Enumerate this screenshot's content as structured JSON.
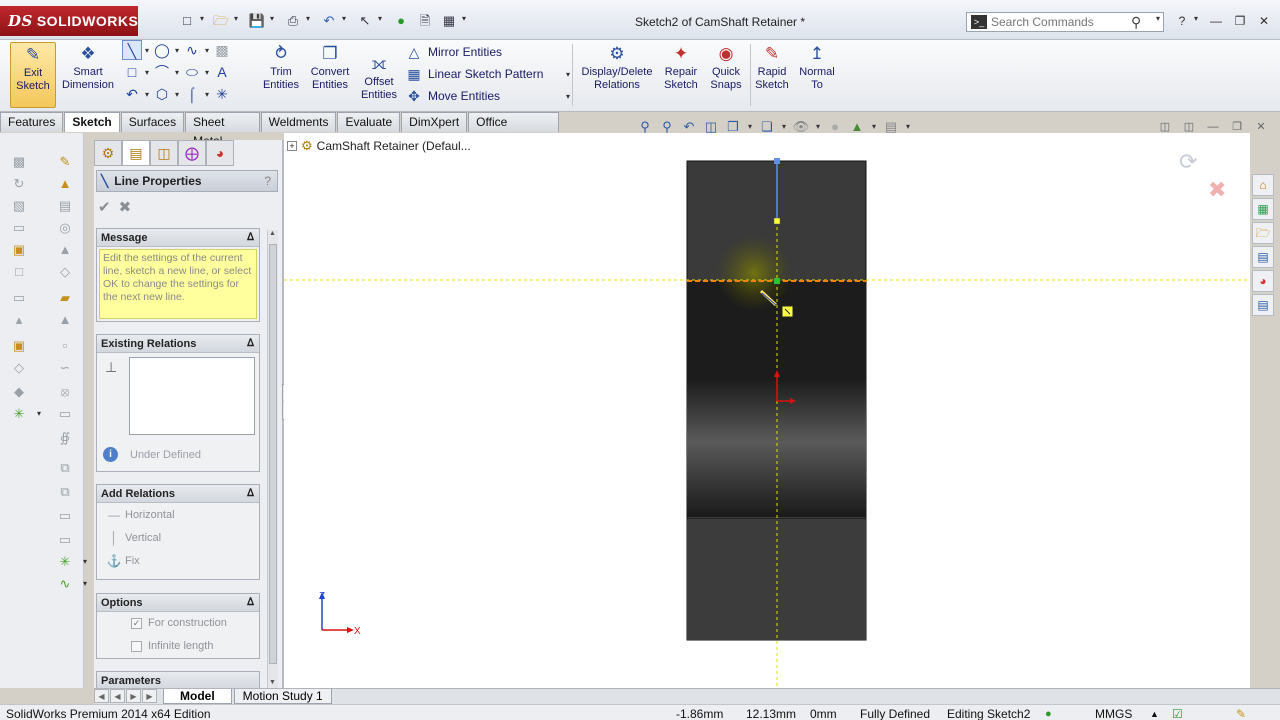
{
  "app": {
    "logo_text": "SOLIDWORKS",
    "logo_mark": "DS",
    "document_title": "Sketch2 of CamShaft Retainer *"
  },
  "search": {
    "placeholder": "Search Commands"
  },
  "commands": {
    "exit_sketch": "Exit Sketch",
    "smart_dimension": "Smart Dimension",
    "trim_entities": "Trim Entities",
    "convert_entities": "Convert Entities",
    "offset_entities": "Offset Entities",
    "mirror_entities": "Mirror Entities",
    "linear_sketch_pattern": "Linear Sketch Pattern",
    "move_entities": "Move Entities",
    "display_delete_relations": "Display/Delete Relations",
    "repair_sketch": "Repair Sketch",
    "quick_snaps": "Quick Snaps",
    "rapid_sketch": "Rapid Sketch",
    "normal_to": "Normal To"
  },
  "tabs": [
    "Features",
    "Sketch",
    "Surfaces",
    "Sheet Metal",
    "Weldments",
    "Evaluate",
    "DimXpert",
    "Office Products"
  ],
  "active_tab": "Sketch",
  "tree": {
    "root": "CamShaft Retainer  (Defaul..."
  },
  "property_manager": {
    "title": "Line Properties",
    "help": "?",
    "message_title": "Message",
    "message_text": "Edit the settings of the current line, sketch a new line, or select OK to change the settings for the next new line.",
    "existing_relations_title": "Existing Relations",
    "status": "Under Defined",
    "add_relations_title": "Add Relations",
    "add_relations": [
      "Horizontal",
      "Vertical",
      "Fix"
    ],
    "options_title": "Options",
    "options": [
      {
        "label": "For construction",
        "checked": true
      },
      {
        "label": "Infinite length",
        "checked": false
      }
    ],
    "parameters_title": "Parameters"
  },
  "triad": {
    "z": "Z",
    "x": "X"
  },
  "bottom_tabs": [
    "Model",
    "Motion Study 1"
  ],
  "status": {
    "edition": "SolidWorks Premium 2014 x64 Edition",
    "x": "-1.86mm",
    "y": "12.13mm",
    "z": "0mm",
    "defined": "Fully Defined",
    "editing": "Editing Sketch2",
    "units": "MMGS"
  },
  "colors": {
    "construction_line": "#e0e000",
    "highlight_line": "#ff7f00",
    "model_dark": "#2b2b2b",
    "sketch_blue": "#3a6fd8",
    "origin_red": "#dd1111"
  }
}
